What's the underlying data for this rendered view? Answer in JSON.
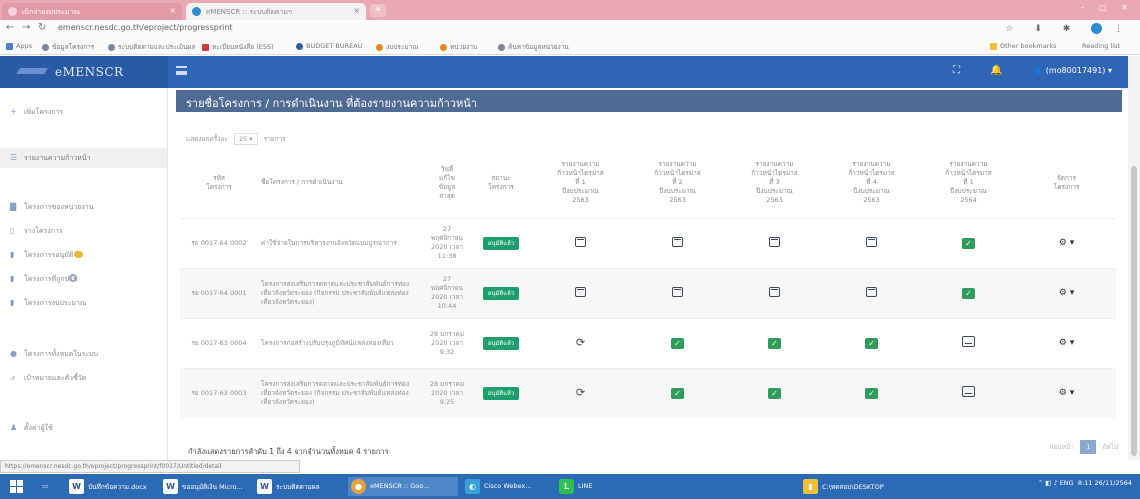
{
  "browser": {
    "tabs": [
      {
        "title": "เบิกจ่ายงบประมาณ",
        "active": false
      },
      {
        "title": "eMENSCR :: ระบบติดตามฯ",
        "active": true
      }
    ],
    "url": "emenscr.nesdc.go.th/eproject/progressprint",
    "bookmarks": [
      "Apps",
      "ข้อมูลโครงการ",
      "ระบบติดตามและประเมินผล",
      "ทะเบียนหนังสือ (ESS)",
      "BUDGET BUREAU",
      "งบประมาณ",
      "หน่วยงาน",
      "ค้นหาข้อมูลหน่วยงาน"
    ],
    "other_bookmarks": "Other bookmarks",
    "reading_list": "Reading list"
  },
  "app": {
    "brand": "eMENSCR",
    "user": "(mo80017491)"
  },
  "sidebar": {
    "items": [
      {
        "section": "",
        "label": "เพิ่มโครงการ",
        "icon": "plus-icon",
        "active": false
      },
      {
        "section": "",
        "label": "รายงานความก้าวหน้า",
        "icon": "list-icon",
        "active": true
      },
      {
        "section": "",
        "label": "โครงการของหน่วยงาน",
        "icon": "folder-icon",
        "active": false
      },
      {
        "section": "",
        "label": "ร่างโครงการ",
        "icon": "file-icon",
        "active": false
      },
      {
        "section": "",
        "label": "โครงการรอนุมัติ",
        "icon": "clipboard-icon",
        "active": false
      },
      {
        "section": "",
        "label": "โครงการที่ถูกปรับ",
        "icon": "clipboard-icon",
        "active": false
      },
      {
        "section": "",
        "label": "โครงการงบประมาณ",
        "icon": "clipboard-icon",
        "active": false
      },
      {
        "section": "",
        "label": "โครงการทั้งหมดในระบบ",
        "icon": "users-icon",
        "active": false
      },
      {
        "section": "",
        "label": "เป้าหมายและตัวชี้วัด",
        "icon": "chart-icon",
        "active": false
      },
      {
        "section": "",
        "label": "ตั้งค่าผู้ใช้",
        "icon": "user-icon",
        "active": false
      }
    ]
  },
  "main": {
    "title": "รายชื่อโครงการ / การดำเนินงาน ที่ต้องรายงานความก้าวหน้า",
    "show_prefix": "แสดงผลครั้งละ",
    "show_value": "25",
    "show_suffix": "รายการ",
    "columns": [
      "รหัส\nโครงการ",
      "ชื่อโครงการ / การดำเนินงาน",
      "วันที่\nแก้ไข\nข้อมูล\nล่าสุด",
      "สถานะ\nโครงการ",
      "รายงานความ\nก้าวหน้าไตรมาส\nที่ 1\nปีงบประมาณ\n2563",
      "รายงานความ\nก้าวหน้าไตรมาส\nที่ 2\nปีงบประมาณ\n2563",
      "รายงานความ\nก้าวหน้าไตรมาส\nที่ 3\nปีงบประมาณ\n2563",
      "รายงานความ\nก้าวหน้าไตรมาส\nที่ 4\nปีงบประมาณ\n2563",
      "รายงานความ\nก้าวหน้าไตรมาส\nที่ 1\nปีงบประมาณ\n2564",
      "จัดการ\nโครงการ"
    ],
    "rows": [
      {
        "code": "รย 0017-64 0002",
        "name": "ค่าใช้จ่ายในการบริหารงานจังหวัดแบบบูรณาการ",
        "date": "27 พฤศจิกายน 2020 เวลา 11:38",
        "status": "อนุมัติแล้ว",
        "q": [
          "calendar",
          "calendar",
          "calendar",
          "calendar",
          "check"
        ]
      },
      {
        "code": "รย 0017-64 0001",
        "name": "โครงการส่งเสริมการตลาดและประชาสัมพันธ์การท่องเที่ยวจังหวัดระยอง (กิจกรรม ประชาสัมพันธ์แหล่งท่องเที่ยวจังหวัดระยอง)",
        "date": "27 พฤศจิกายน 2020 เวลา 10:44",
        "status": "อนุมัติแล้ว",
        "q": [
          "calendar",
          "calendar",
          "calendar",
          "calendar",
          "check"
        ]
      },
      {
        "code": "รย 0017-63 0004",
        "name": "โครงการก่อสร้างปรับปรุงภูมิทัศน์แหล่งท่องเที่ยว",
        "date": "28 มกราคม 2020 เวลา 9:32",
        "status": "อนุมัติแล้ว",
        "q": [
          "refresh",
          "check",
          "check",
          "check",
          "report"
        ]
      },
      {
        "code": "รย 0017-63 0003",
        "name": "โครงการส่งเสริมการตลาดและประชาสัมพันธ์การท่องเที่ยวจังหวัดระยอง (กิจกรรม ประชาสัมพันธ์แหล่งท่องเที่ยวจังหวัดระยอง)",
        "date": "28 มกราคม 2020 เวลา 9:25",
        "status": "อนุมัติแล้ว",
        "q": [
          "refresh",
          "check",
          "check",
          "check",
          "report"
        ]
      }
    ],
    "footer": "กำลังแสดงรายการลำดับ 1 ถึง 4 จากจำนวนทั้งหมด 4 รายการ",
    "pager": {
      "prev": "ก่อนหน้า",
      "current": "1",
      "next": "ถัดไป"
    }
  },
  "status_url": "https://emenscr.nesdc.go.th/eproject/progressprint/f0017/Untitled/detail",
  "taskbar": {
    "items": [
      "บันทึกข้อความ.docx",
      "ขออนุมัติเงิน Micro...",
      "ระบบติดตามผล",
      "eMENSCR :: Goo...",
      "Cisco Webex...",
      "LINE",
      "C:\\ทดสอบ\\DESKTOP"
    ],
    "clock_time": "8:11",
    "clock_date": "26/11/2564",
    "lang": "ENG"
  }
}
